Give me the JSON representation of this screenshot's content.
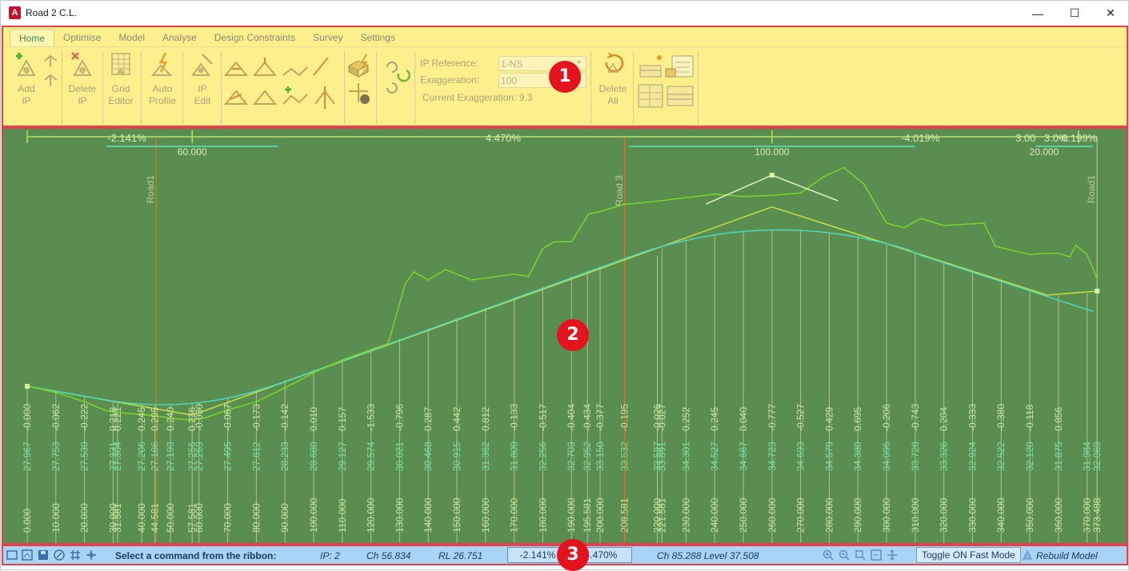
{
  "window": {
    "title": "Road 2 C.L.",
    "minimize": "—",
    "maximize": "☐",
    "close": "✕"
  },
  "ribbon": {
    "tabs": [
      "Home",
      "Optimise",
      "Model",
      "Analyse",
      "Design Constraints",
      "Survey",
      "Settings"
    ],
    "buttons": {
      "add_ip": [
        "Add",
        "IP"
      ],
      "delete_ip": [
        "Delete",
        "IP"
      ],
      "grid_editor": [
        "Grid",
        "Editor"
      ],
      "auto_profile": [
        "Auto",
        "Profile"
      ],
      "ip_edit": [
        "IP",
        "Edit"
      ],
      "delete_all": [
        "Delete",
        "All"
      ]
    },
    "ip_reference_label": "IP Reference:",
    "ip_reference_value": "1-NS",
    "exaggeration_label": "Exaggeration:",
    "exaggeration_value": "100",
    "current_exaggeration": "Current Exaggeration: 9.3"
  },
  "markers": [
    "1",
    "2",
    "3"
  ],
  "profile": {
    "grades": [
      "-2.141%",
      "4.470%",
      "-4.019%",
      "3.00",
      "3.0%",
      "-0.199%"
    ],
    "vc_lengths": [
      "60.000",
      "100.000",
      "20.000"
    ],
    "roads": [
      "Road1",
      "Road 3",
      "Road1"
    ],
    "offsets": [
      "-0.000",
      "-0.062",
      "-0.222",
      "0.218",
      "0.221",
      "0.245",
      "0.295",
      "0.240",
      "0.236",
      "-0.030",
      "-0.067",
      "-0.173",
      "-0.142",
      "0.010",
      "0.157",
      "-1.533",
      "-0.796",
      "0.287",
      "0.442",
      "0.812",
      "-0.133",
      "-0.517",
      "-0.404",
      "-0.434",
      "-0.377",
      "-0.195",
      "-0.026",
      "-0.027",
      "0.252",
      "0.245",
      "0.040",
      "-0.777",
      "-0.527",
      "0.429",
      "0.695",
      "-0.206",
      "-0.743",
      "0.204",
      "-0.333",
      "-0.380",
      "-0.118",
      "0.856"
    ],
    "levels": [
      "27.967",
      "27.753",
      "27.539",
      "27.331",
      "27.304",
      "27.206",
      "27.186",
      "27.193",
      "27.256",
      "27.269",
      "27.495",
      "27.812",
      "28.233",
      "28.680",
      "29.127",
      "29.574",
      "30.021",
      "30.468",
      "30.915",
      "31.362",
      "31.809",
      "32.256",
      "32.703",
      "32.952",
      "33.150",
      "33.532",
      "33.597",
      "33.891",
      "34.301",
      "34.527",
      "34.667",
      "34.723",
      "34.693",
      "34.579",
      "34.380",
      "34.096",
      "33.728",
      "33.326",
      "32.924",
      "32.522",
      "32.120",
      "31.875",
      "31.984",
      "32.069"
    ],
    "chainages": [
      "0.000",
      "10.000",
      "20.000",
      "30.000",
      "31.581",
      "40.000",
      "44.581",
      "50.000",
      "57.581",
      "60.000",
      "70.000",
      "80.000",
      "90.000",
      "100.000",
      "110.000",
      "120.000",
      "130.000",
      "140.000",
      "150.000",
      "160.000",
      "170.000",
      "180.000",
      "190.000",
      "195.581",
      "200.000",
      "208.581",
      "220.000",
      "221.581",
      "230.000",
      "240.000",
      "250.000",
      "260.000",
      "270.000",
      "280.000",
      "290.000",
      "300.000",
      "310.000",
      "320.000",
      "330.000",
      "340.000",
      "350.000",
      "360.000",
      "370.000",
      "373.488"
    ]
  },
  "status": {
    "prompt": "Select a command from the ribbon:",
    "ip": "IP: 2",
    "ch": "Ch 56.834",
    "rl": "RL 26.751",
    "grade_in": "-2.141%",
    "grade_out": "4.470%",
    "cursor": "Ch 85.288 Level 37.508",
    "fast_mode": "Toggle ON Fast Mode",
    "rebuild": "Rebuild Model"
  }
}
